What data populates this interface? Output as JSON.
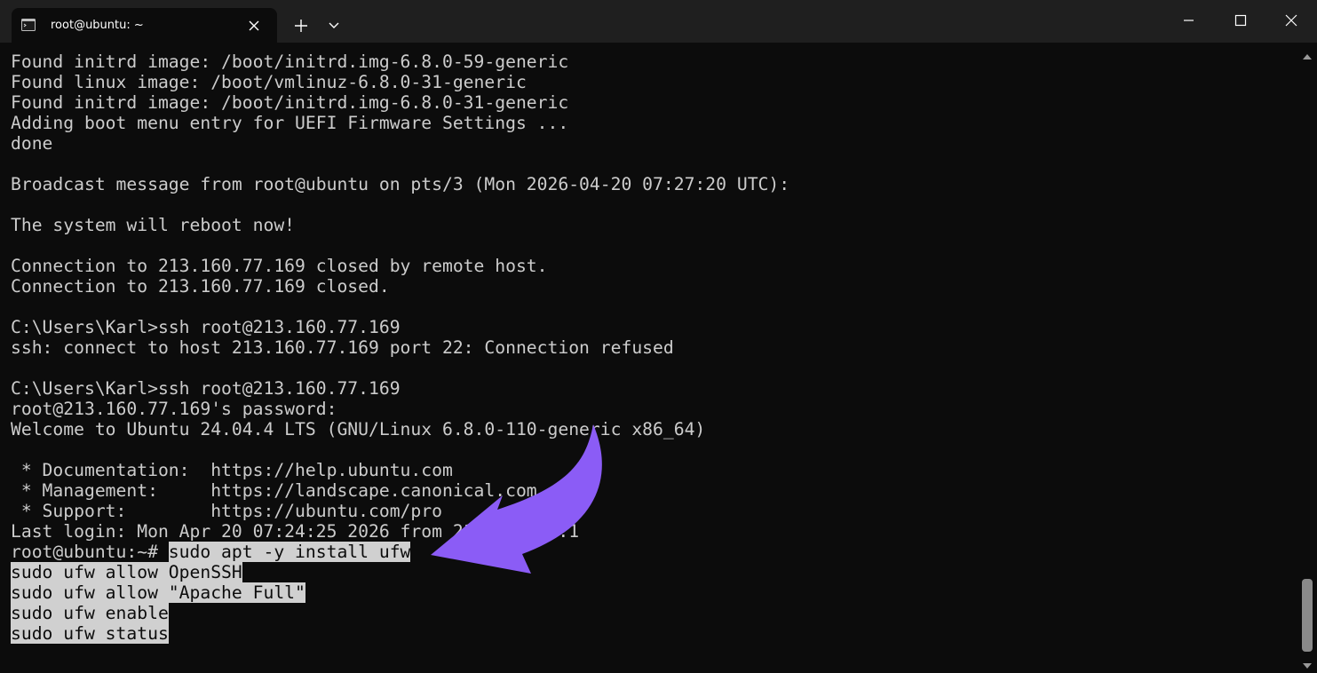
{
  "window": {
    "tab_title": "root@ubuntu: ~",
    "tab_icon": "terminal-icon",
    "new_tab_icon": "plus-icon",
    "dropdown_icon": "chevron-down-icon",
    "minimize_icon": "minimize-icon",
    "maximize_icon": "maximize-icon",
    "close_icon": "close-icon"
  },
  "terminal": {
    "background": "#0c0c0c",
    "text_color": "#cccccc",
    "selection_color": "#d0d0d0",
    "lines": [
      "Found initrd image: /boot/initrd.img-6.8.0-59-generic",
      "Found linux image: /boot/vmlinuz-6.8.0-31-generic",
      "Found initrd image: /boot/initrd.img-6.8.0-31-generic",
      "Adding boot menu entry for UEFI Firmware Settings ...",
      "done",
      "",
      "Broadcast message from root@ubuntu on pts/3 (Mon 2026-04-20 07:27:20 UTC):",
      "",
      "The system will reboot now!",
      "",
      "Connection to 213.160.77.169 closed by remote host.",
      "Connection to 213.160.77.169 closed.",
      "",
      "C:\\Users\\Karl>ssh root@213.160.77.169",
      "ssh: connect to host 213.160.77.169 port 22: Connection refused",
      "",
      "C:\\Users\\Karl>ssh root@213.160.77.169",
      "root@213.160.77.169's password:",
      "Welcome to Ubuntu 24.04.4 LTS (GNU/Linux 6.8.0-110-generic x86_64)",
      "",
      " * Documentation:  https://help.ubuntu.com",
      " * Management:     https://landscape.canonical.com",
      " * Support:        https://ubuntu.com/pro",
      "Last login: Mon Apr 20 07:24:25 2026 from 213.160.77.1"
    ],
    "prompt": "root@ubuntu:~# ",
    "selected_commands": [
      "sudo apt -y install ufw",
      "sudo ufw allow OpenSSH",
      "sudo ufw allow \"Apache Full\"",
      "sudo ufw enable",
      "sudo ufw status"
    ]
  },
  "annotation": {
    "arrow_color": "#8b5cf6",
    "arrow_icon": "curved-arrow-icon"
  }
}
